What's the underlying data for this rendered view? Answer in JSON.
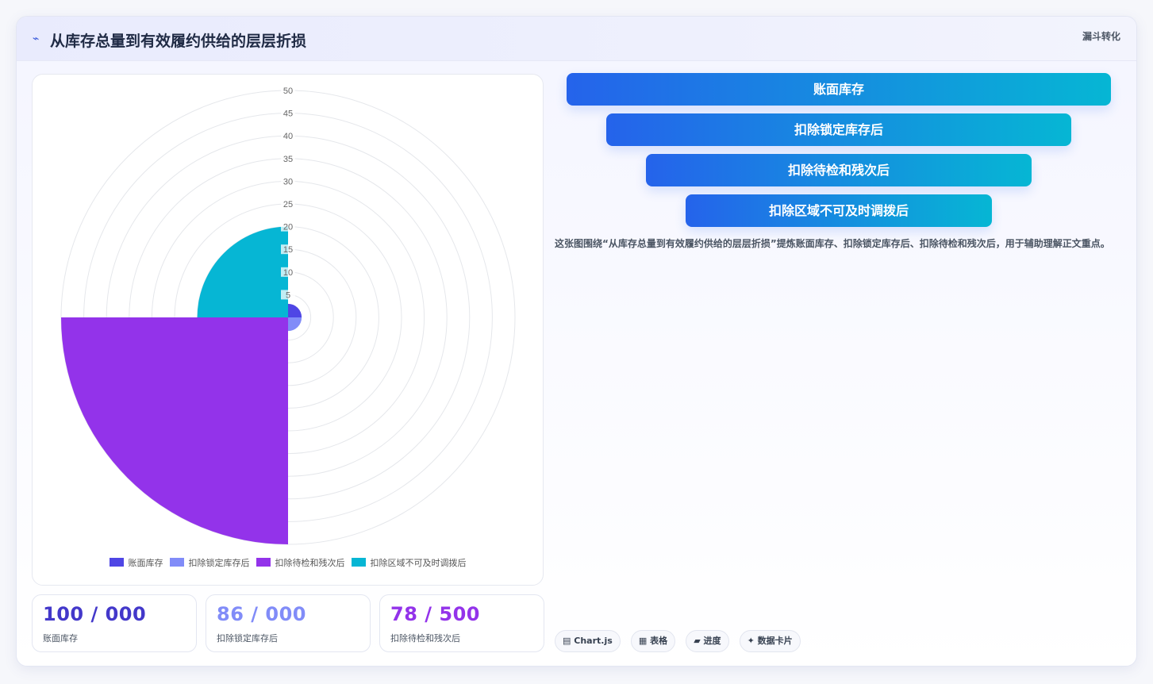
{
  "header": {
    "glyph": "⌁",
    "title": "从库存总量到有效履约供给的层层折损",
    "tag": "漏斗转化"
  },
  "chart_data": {
    "type": "polarArea",
    "title": "",
    "categories": [
      "账面库存",
      "扣除锁定库存后",
      "扣除待检和残次后",
      "扣除区域不可及时调拨后"
    ],
    "values": [
      3,
      3,
      50,
      20
    ],
    "colors": [
      "#4f46e5",
      "#818cf8",
      "#9333ea",
      "#06b6d4"
    ],
    "r_max": 50,
    "r_ticks": [
      5,
      10,
      15,
      20,
      25,
      30,
      35,
      40,
      45,
      50
    ],
    "grid": true,
    "legend_position": "bottom"
  },
  "stats": [
    {
      "value": "100 / 000",
      "label": "账面库存",
      "color": "#4338ca"
    },
    {
      "value": "86 / 000",
      "label": "扣除锁定库存后",
      "color": "#818cf8"
    },
    {
      "value": "78 / 500",
      "label": "扣除待检和残次后",
      "color": "#9333ea"
    }
  ],
  "funnel": [
    "账面库存",
    "扣除锁定库存后",
    "扣除待检和残次后",
    "扣除区域不可及时调拨后"
  ],
  "description": "这张图围绕“从库存总量到有效履约供给的层层折损”提炼账面库存、扣除锁定库存后、扣除待检和残次后，用于辅助理解正文重点。",
  "tags": [
    {
      "icon": "▤",
      "label": "Chart.js"
    },
    {
      "icon": "▦",
      "label": "表格"
    },
    {
      "icon": "▰",
      "label": "进度"
    },
    {
      "icon": "✦",
      "label": "数据卡片"
    }
  ]
}
